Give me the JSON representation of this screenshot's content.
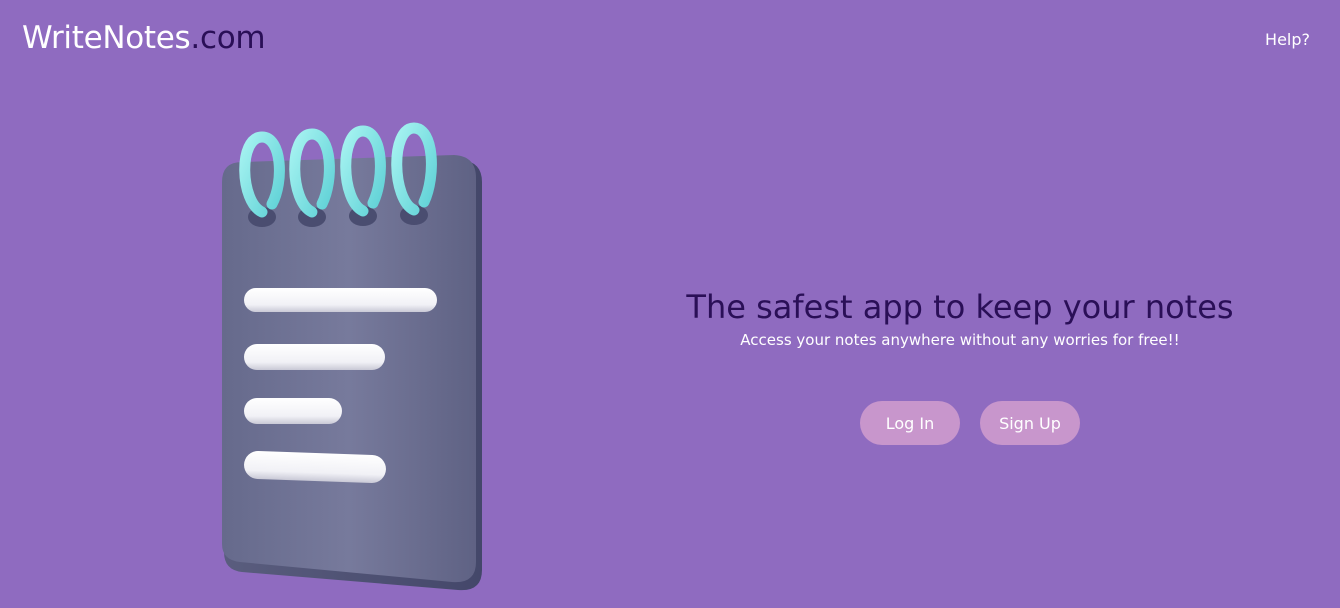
{
  "header": {
    "brand_main": "WriteNotes",
    "brand_tld": ".com",
    "help_label": "Help?"
  },
  "hero": {
    "title": "The safest app to keep your notes",
    "subtitle": "Access your notes anywhere without any worries for free!!",
    "login_label": "Log In",
    "signup_label": "Sign Up"
  },
  "illustration": {
    "icon": "spiral-notepad-icon"
  },
  "colors": {
    "background": "#8f6bc0",
    "brand_accent": "#2a0f57",
    "button": "#c896cc",
    "notepad_body": "#727497",
    "notepad_rings": "#7fe3e5"
  }
}
